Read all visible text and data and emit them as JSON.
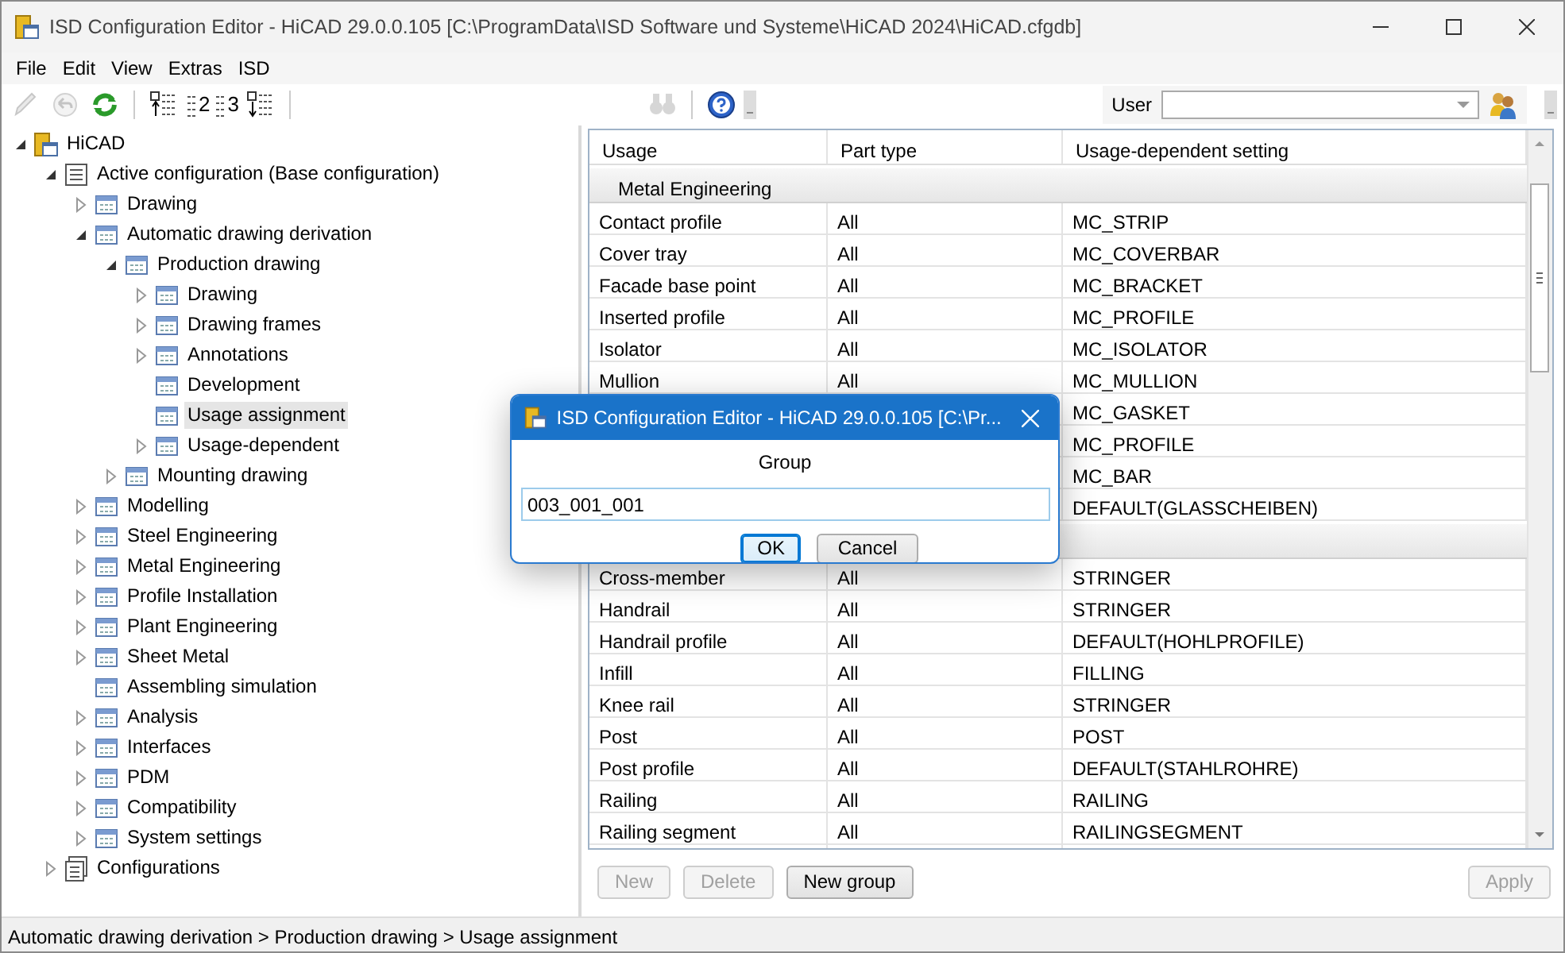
{
  "window": {
    "title": "ISD Configuration Editor  - HiCAD 29.0.0.105 [C:\\ProgramData\\ISD Software und Systeme\\HiCAD 2024\\HiCAD.cfgdb]"
  },
  "menu": [
    "File",
    "Edit",
    "View",
    "Extras",
    "ISD"
  ],
  "toolbar": [
    {
      "kind": "pencil",
      "disabled": true
    },
    {
      "kind": "undo",
      "disabled": true
    },
    {
      "kind": "refresh",
      "disabled": false
    },
    {
      "kind": "sep"
    },
    {
      "kind": "collapse",
      "disabled": false
    },
    {
      "kind": "level",
      "label": "2",
      "disabled": false
    },
    {
      "kind": "level",
      "label": "3",
      "disabled": false
    },
    {
      "kind": "expand",
      "disabled": false
    },
    {
      "kind": "sep"
    },
    {
      "kind": "gap"
    },
    {
      "kind": "find",
      "disabled": true
    },
    {
      "kind": "sep"
    },
    {
      "kind": "help",
      "disabled": false
    }
  ],
  "user": {
    "label": "User"
  },
  "tree": [
    {
      "label": "HiCAD",
      "kind": "root",
      "expanded": true,
      "selected": false,
      "children": [
        {
          "label": "Active configuration (Base configuration)",
          "kind": "config",
          "expanded": true,
          "selected": false,
          "children": [
            {
              "label": "Drawing",
              "kind": "table",
              "expanded": false,
              "selected": false
            },
            {
              "label": "Automatic drawing derivation",
              "kind": "table",
              "expanded": true,
              "selected": false,
              "children": [
                {
                  "label": "Production drawing",
                  "kind": "table",
                  "expanded": true,
                  "selected": false,
                  "children": [
                    {
                      "label": "Drawing",
                      "kind": "table",
                      "expanded": false,
                      "selected": false
                    },
                    {
                      "label": "Drawing frames",
                      "kind": "table",
                      "expanded": false,
                      "selected": false
                    },
                    {
                      "label": "Annotations",
                      "kind": "table",
                      "expanded": false,
                      "selected": false
                    },
                    {
                      "label": "Development",
                      "kind": "table",
                      "selected": false
                    },
                    {
                      "label": "Usage assignment",
                      "kind": "table",
                      "selected": true
                    },
                    {
                      "label": "Usage-dependent",
                      "kind": "table",
                      "expanded": false,
                      "selected": false
                    }
                  ]
                },
                {
                  "label": "Mounting drawing",
                  "kind": "table",
                  "expanded": false,
                  "selected": false
                }
              ]
            },
            {
              "label": "Modelling",
              "kind": "table",
              "expanded": false,
              "selected": false
            },
            {
              "label": "Steel Engineering",
              "kind": "table",
              "expanded": false,
              "selected": false
            },
            {
              "label": "Metal Engineering",
              "kind": "table",
              "expanded": false,
              "selected": false
            },
            {
              "label": "Profile Installation",
              "kind": "table",
              "expanded": false,
              "selected": false
            },
            {
              "label": "Plant Engineering",
              "kind": "table",
              "expanded": false,
              "selected": false
            },
            {
              "label": "Sheet Metal",
              "kind": "table",
              "expanded": false,
              "selected": false
            },
            {
              "label": "Assembling simulation",
              "kind": "table",
              "selected": false
            },
            {
              "label": "Analysis",
              "kind": "table",
              "expanded": false,
              "selected": false
            },
            {
              "label": "Interfaces",
              "kind": "table",
              "expanded": false,
              "selected": false
            },
            {
              "label": "PDM",
              "kind": "table",
              "expanded": false,
              "selected": false
            },
            {
              "label": "Compatibility",
              "kind": "table",
              "expanded": false,
              "selected": false
            },
            {
              "label": "System settings",
              "kind": "table",
              "expanded": false,
              "selected": false
            }
          ]
        },
        {
          "label": "Configurations",
          "kind": "configs",
          "expanded": false,
          "selected": false
        }
      ]
    }
  ],
  "table": {
    "columns": [
      "Usage",
      "Part type",
      "Usage-dependent setting"
    ],
    "groups": [
      {
        "title": "Metal Engineering",
        "rows": [
          {
            "usage": "Contact profile",
            "part_type": "All",
            "setting": "MC_STRIP"
          },
          {
            "usage": "Cover tray",
            "part_type": "All",
            "setting": "MC_COVERBAR"
          },
          {
            "usage": "Facade base point",
            "part_type": "All",
            "setting": "MC_BRACKET"
          },
          {
            "usage": "Inserted profile",
            "part_type": "All",
            "setting": "MC_PROFILE"
          },
          {
            "usage": "Isolator",
            "part_type": "All",
            "setting": "MC_ISOLATOR"
          },
          {
            "usage": "Mullion",
            "part_type": "All",
            "setting": "MC_MULLION"
          },
          {
            "setting": "MC_GASKET"
          },
          {
            "setting": "MC_PROFILE"
          },
          {
            "setting": "MC_BAR"
          },
          {
            "setting": "DEFAULT(GLASSCHEIBEN)"
          }
        ]
      },
      {
        "rows": [
          {
            "usage": "Cross-member",
            "part_type": "All",
            "setting": "STRINGER"
          },
          {
            "usage": "Handrail",
            "part_type": "All",
            "setting": "STRINGER"
          },
          {
            "usage": "Handrail profile",
            "part_type": "All",
            "setting": "DEFAULT(HOHLPROFILE)"
          },
          {
            "usage": "Infill",
            "part_type": "All",
            "setting": "FILLING"
          },
          {
            "usage": "Knee rail",
            "part_type": "All",
            "setting": "STRINGER"
          },
          {
            "usage": "Post",
            "part_type": "All",
            "setting": "POST"
          },
          {
            "usage": "Post profile",
            "part_type": "All",
            "setting": "DEFAULT(STAHLROHRE)"
          },
          {
            "usage": "Railing",
            "part_type": "All",
            "setting": "RAILING"
          },
          {
            "usage": "Railing segment",
            "part_type": "All",
            "setting": "RAILINGSEGMENT"
          },
          {}
        ]
      }
    ]
  },
  "buttons": [
    {
      "label": "New",
      "disabled": true
    },
    {
      "label": "Delete",
      "disabled": true
    },
    {
      "label": "New group",
      "disabled": false
    },
    {
      "label": "Apply",
      "disabled": true
    }
  ],
  "status_bar": "Automatic drawing derivation > Production drawing > Usage assignment",
  "dialog": {
    "title": "ISD Configuration Editor  - HiCAD 29.0.0.105 [C:\\Pr...",
    "label": "Group",
    "value": "003_001_001",
    "buttons": [
      {
        "label": "OK",
        "focused": true
      },
      {
        "label": "Cancel",
        "focused": false
      }
    ]
  }
}
